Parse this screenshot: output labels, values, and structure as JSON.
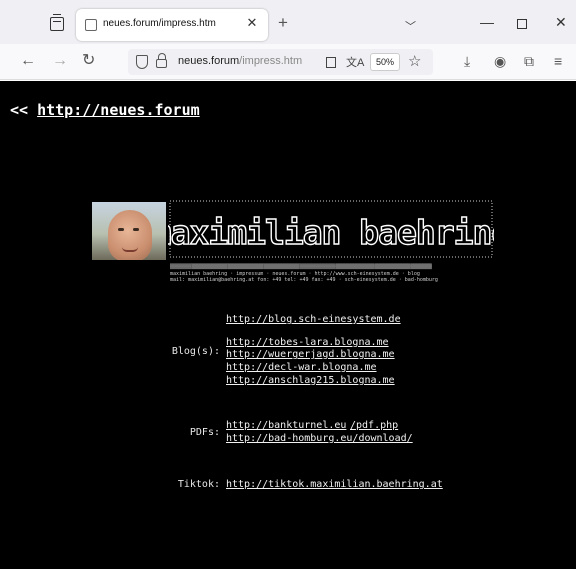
{
  "browser": {
    "tab": {
      "title": "neues.forum/impress.htm"
    },
    "url": {
      "host": "neues.forum",
      "path": "/impress.htm"
    },
    "zoom": "50%"
  },
  "page": {
    "back_link": {
      "prefix": "<< ",
      "text": "http://neues.forum"
    },
    "logo_text": "maximilian baehring",
    "ascii_lines": [
      "▒▒▒▒▒▒▒▒▒▒▒▒▒▒▒▒▒▒▒▒▒▒▒▒▒▒▒▒▒▒▒▒▒▒▒▒▒▒▒▒▒▒▒▒▒▒▒▒▒▒▒▒▒▒▒▒▒▒▒▒▒▒▒▒▒▒▒▒▒▒▒▒▒▒▒▒▒▒▒▒▒▒▒▒▒▒▒",
      "maximilian baehring · impressum · neues.forum · http://www.sch-einesystem.de · blog",
      "mail: maximilian@baehring.at fon: +49 tel: +49 fax: +49 · sch-einesystem.de · bad-homburg"
    ],
    "sections": [
      {
        "label": "",
        "links": [
          "http://blog.sch-einesystem.de"
        ]
      },
      {
        "label": "Blog(s):",
        "links": [
          "http://tobes-lara.blogna.me",
          "http://wuergerjagd.blogna.me",
          "http://decl-war.blogna.me",
          "http://anschlag215.blogna.me"
        ]
      },
      {
        "label": "PDFs:",
        "links": [
          "http://bankturnel.eu",
          "http://bad-homburg.eu/download/"
        ],
        "extra_link": "/pdf.php"
      },
      {
        "label": "Tiktok:",
        "links": [
          "http://tiktok.maximilian.baehring.at"
        ]
      }
    ]
  }
}
